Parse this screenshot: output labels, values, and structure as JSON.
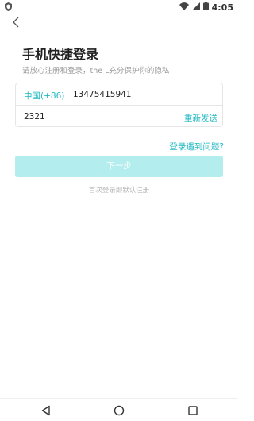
{
  "status_bar": {
    "time": "4:05",
    "icons": [
      "shield-icon",
      "wifi-icon",
      "signal-icon",
      "battery-icon"
    ]
  },
  "nav": {
    "back_icon": "chevron-left-icon"
  },
  "login": {
    "title": "手机快捷登录",
    "subtitle": "请放心注册和登录，the L充分保护你的隐私",
    "country_code": "中国(+86)",
    "phone_number": "13475415941",
    "verification_code": "2321",
    "resend_label": "重新发送",
    "help_link": "登录遇到问题?",
    "next_button": "下一步",
    "hint": "首次登录即默认注册"
  },
  "colors": {
    "accent": "#1fb8c2",
    "button_disabled": "#b4edee",
    "border": "#e6e6e6",
    "muted_text": "#9b9b9b"
  },
  "system_nav": {
    "icons": [
      "back-triangle-icon",
      "home-circle-icon",
      "recent-apps-square-icon"
    ]
  }
}
